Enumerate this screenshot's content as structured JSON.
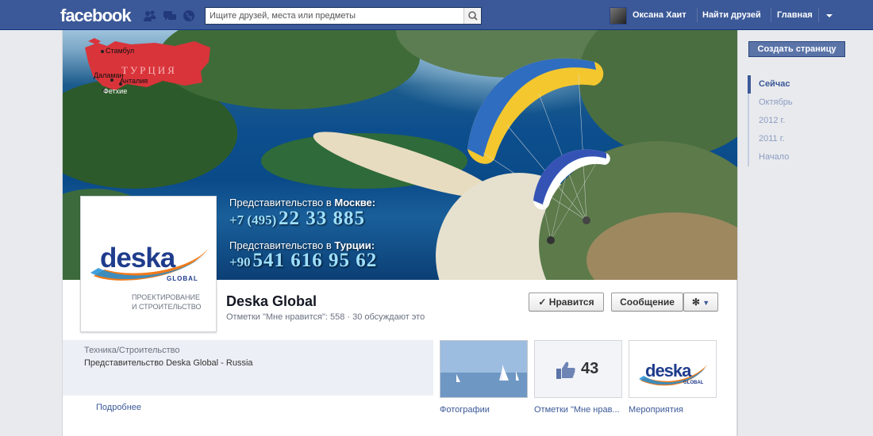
{
  "topbar": {
    "logo": "facebook",
    "search_placeholder": "Ищите друзей, места или предметы",
    "user_name": "Оксана Хаит",
    "find_friends": "Найти друзей",
    "home": "Главная"
  },
  "right_column": {
    "create_page": "Создать страницу",
    "timeline": [
      "Сейчас",
      "Октябрь",
      "2012 г.",
      "2011 г.",
      "Начало"
    ]
  },
  "cover": {
    "map": {
      "country": "ТУРЦИЯ",
      "cities": [
        "Стамбул",
        "Даламан",
        "Анталия",
        "Фетхие"
      ]
    },
    "moscow": {
      "heading_prefix": "Представительство в ",
      "heading_city": "Москве:",
      "phone_prefix": "+7 (495)",
      "phone_number": "22 33 885"
    },
    "turkey": {
      "heading_prefix": "Представительство в ",
      "heading_city": "Турции:",
      "phone_prefix": "+90",
      "phone_number": "541 616 95 62"
    }
  },
  "profile": {
    "logo_word": "deska",
    "logo_global": "GLOBAL",
    "logo_tagline_1": "ПРОЕКТИРОВАНИЕ",
    "logo_tagline_2": "И СТРОИТЕЛЬСТВО"
  },
  "page": {
    "name": "Deska Global",
    "stats": "Отметки \"Мне нравится\": 558 · 30 обсуждают это",
    "like_button": "Нравится",
    "message_button": "Сообщение"
  },
  "about": {
    "category": "Техника/Строительство",
    "description": "Представительство Deska Global - Russia",
    "more": "Подробнее"
  },
  "apps": {
    "photos_label": "Фотографии",
    "likes_label": "Отметки \"Мне нрав...",
    "likes_count": "43",
    "events_label": "Мероприятия",
    "events_logo": "deska",
    "events_logo_sub": "GLOBAL"
  },
  "colors": {
    "brand_blue": "#3b5998",
    "link_blue": "#3b5998",
    "map_red": "#d9343a",
    "phone_cyan": "#9ee0ff"
  }
}
